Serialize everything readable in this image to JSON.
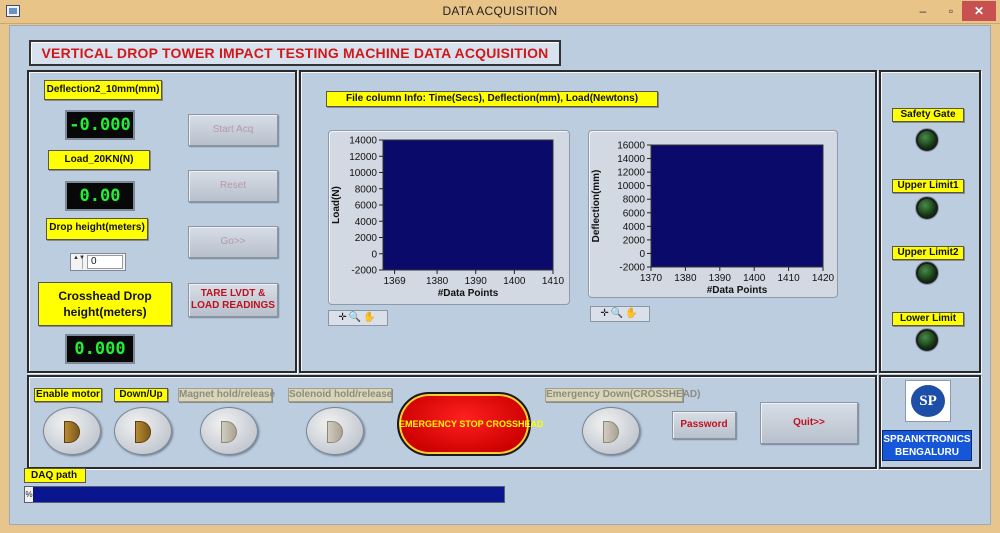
{
  "window": {
    "title": "DATA ACQUISITION",
    "minimize_glyph": "–",
    "maximize_glyph": "▫",
    "close_glyph": "✕"
  },
  "header": {
    "title": "VERTICAL DROP TOWER IMPACT TESTING MACHINE DATA ACQUISITION"
  },
  "left_panel": {
    "deflection_label": "Deflection2_10mm(mm)",
    "deflection_value": "-0.000",
    "load_label": "Load_20KN(N)",
    "load_value": "0.00",
    "drop_height_label": "Drop height(meters)",
    "drop_height_input": "0",
    "stepper_glyph": "▲▼",
    "crosshead_label": "Crosshead Drop height(meters)",
    "crosshead_value": "0.000"
  },
  "controls": {
    "start_acq": "Start Acq",
    "reset": "Reset",
    "go": "Go>>",
    "tare": "TARE LVDT & LOAD READINGS"
  },
  "info_label": "File column Info: Time(Secs), Deflection(mm), Load(Newtons)",
  "chart_data": [
    {
      "type": "line",
      "ylabel": "Load(N)",
      "xlabel": "#Data Points",
      "xlim": [
        1366,
        1410
      ],
      "ylim": [
        -2000,
        14000
      ],
      "x_ticks": [
        "1369",
        "1380",
        "1390",
        "1400",
        "1410"
      ],
      "y_ticks": [
        "14000",
        "12000",
        "10000",
        "8000",
        "6000",
        "4000",
        "2000",
        "0",
        "-2000"
      ],
      "plot_bg": "#0a0a6a",
      "series": []
    },
    {
      "type": "line",
      "ylabel": "Deflection(mm)",
      "xlabel": "#Data Points",
      "xlim": [
        1370,
        1420
      ],
      "ylim": [
        -2000,
        16000
      ],
      "x_ticks": [
        "1370",
        "1380",
        "1390",
        "1400",
        "1410",
        "1420"
      ],
      "y_ticks": [
        "16000",
        "14000",
        "12000",
        "10000",
        "8000",
        "6000",
        "4000",
        "2000",
        "0",
        "-2000"
      ],
      "plot_bg": "#0a0a6a",
      "series": []
    }
  ],
  "graph_tools": {
    "glyphs": "✛🔍✋"
  },
  "indicators": {
    "safety_gate": "Safety Gate",
    "upper_limit1": "Upper Limit1",
    "upper_limit2": "Upper Limit2",
    "lower_limit": "Lower Limit"
  },
  "bottom": {
    "enable_motor": "Enable motor",
    "down_up": "Down/Up",
    "magnet": "Magnet hold/release",
    "solenoid": "Solenoid hold/release",
    "emergency_stop": "EMERGENCY STOP CROSSHEAD",
    "emergency_down": "Emergency Down(CROSSHEAD)",
    "password": "Password",
    "quit": "Quit>>"
  },
  "logo": {
    "mark": "SP",
    "company_line1": "SPRANKTRONICS",
    "company_line2": "BENGALURU"
  },
  "daq": {
    "label": "DAQ path",
    "prefix": "%",
    "path_value": ""
  },
  "colors": {
    "window_frame": "#e8c489",
    "panel": "#bccde0",
    "label_yellow": "#ffff00",
    "display_green": "#22ee33",
    "plot_navy": "#0a0a6a",
    "title_red": "#d01818"
  }
}
